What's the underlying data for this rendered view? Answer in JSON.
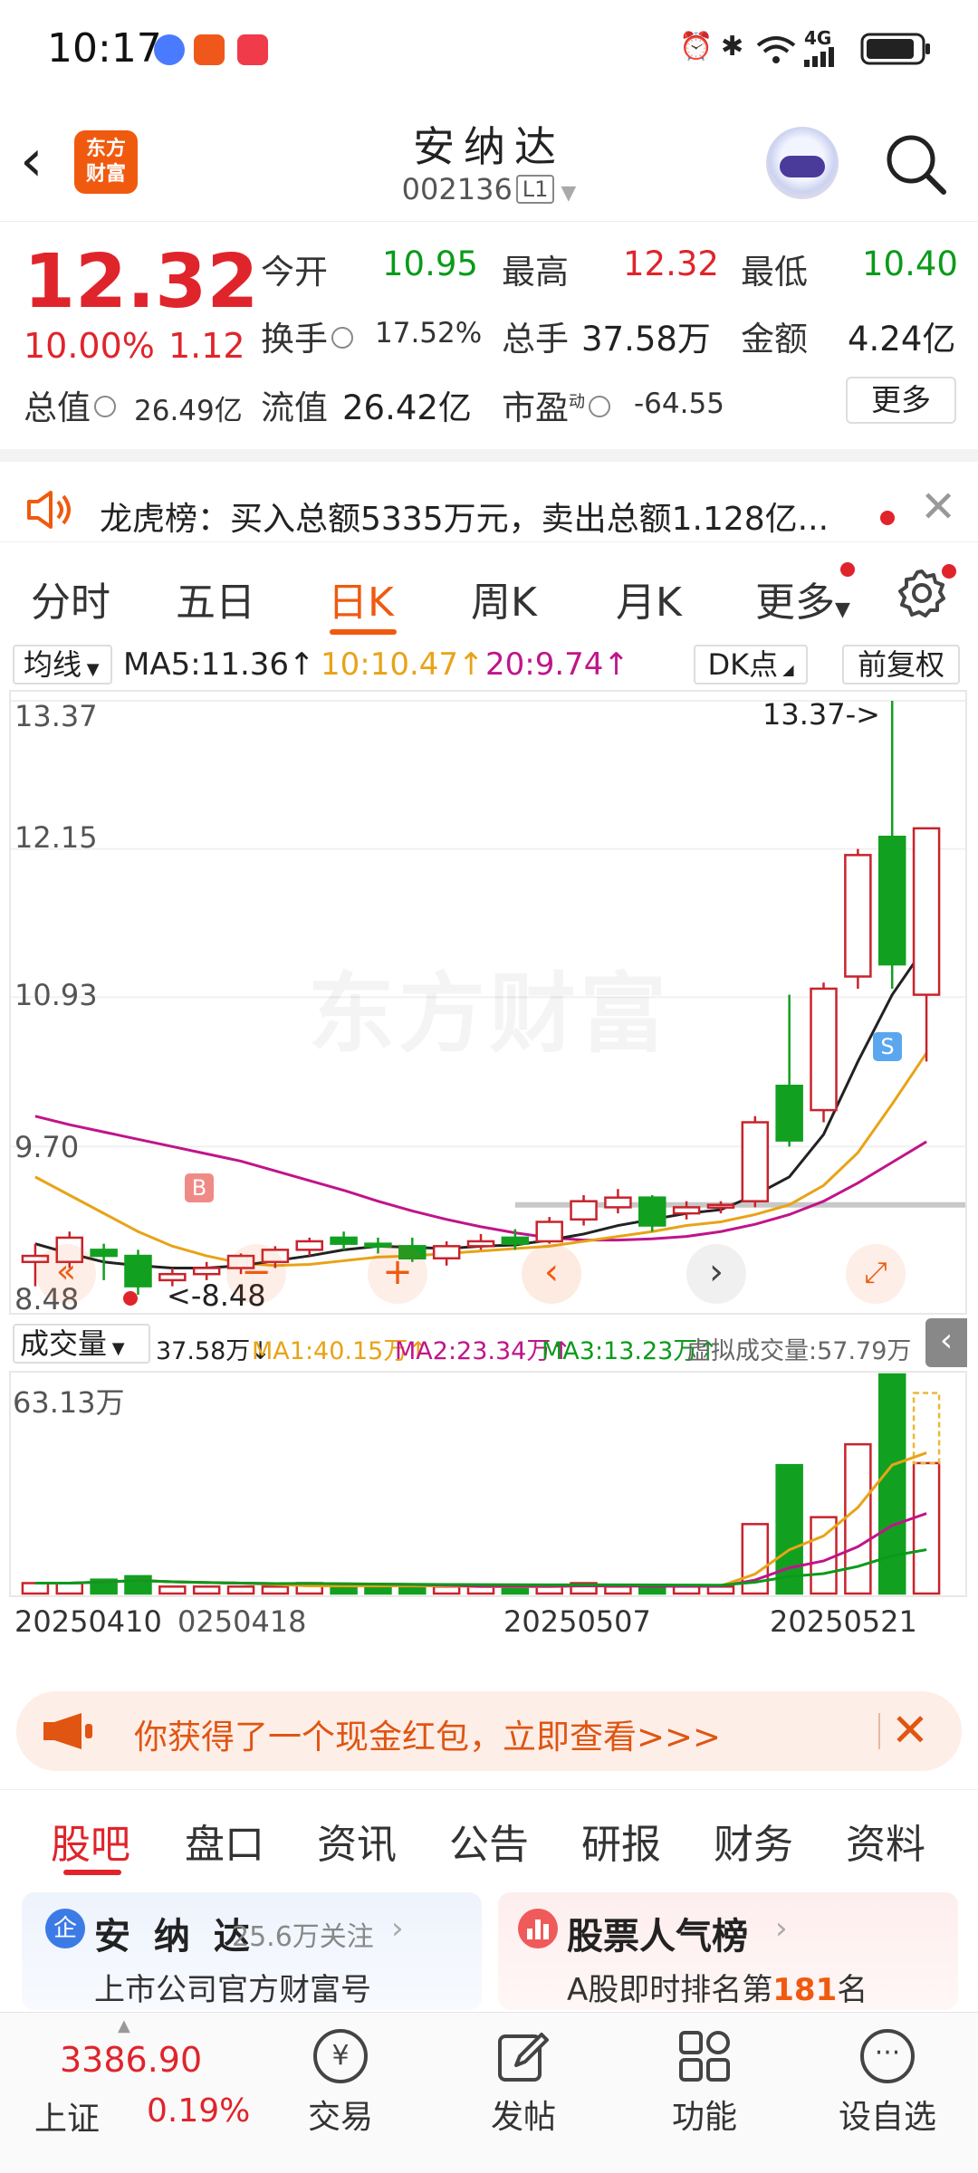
{
  "status_bar": {
    "time": "10:17",
    "network": "4G",
    "battery_icon": "battery-icon"
  },
  "header": {
    "name": "安纳达",
    "code": "002136",
    "level": "L1",
    "logo_text": "东方\n财富"
  },
  "quote": {
    "price": "12.32",
    "change_pct": "10.00%",
    "change": "1.12",
    "open_label": "今开",
    "open": "10.95",
    "high_label": "最高",
    "high": "12.32",
    "low_label": "最低",
    "low": "10.40",
    "turnover_label": "换手",
    "turnover": "17.52%",
    "vol_label": "总手",
    "vol": "37.58万",
    "amount_label": "金额",
    "amount": "4.24亿",
    "mktcap_label": "总值",
    "mktcap": "26.49亿",
    "float_label": "流值",
    "float": "26.42亿",
    "pe_label": "市盈",
    "pe_sup": "动",
    "pe": "-64.55",
    "more": "更多"
  },
  "notice": {
    "text": "龙虎榜：买入总额5335万元，卖出总额1.128亿..."
  },
  "tabs": [
    "分时",
    "五日",
    "日K",
    "周K",
    "月K",
    "更多"
  ],
  "ma_bar": {
    "dropdown": "均线",
    "ma5": "MA5:11.36↑",
    "ma10": "10:10.47↑",
    "ma20": "20:9.74↑",
    "dk": "DK点",
    "adjust": "前复权"
  },
  "chart": {
    "y_labels": [
      "13.37",
      "12.15",
      "10.93",
      "9.70",
      "8.48"
    ],
    "max_marker": "13.37->",
    "min_marker": "<-8.48",
    "buy_marker": "B",
    "sell_marker": "S",
    "watermark": "东方财富"
  },
  "volume_bar": {
    "dropdown": "成交量",
    "vol": "37.58万↓",
    "ma1": "MA1:40.15万↑",
    "ma2": "MA2:23.34万↑",
    "ma3": "MA3:13.23万↑",
    "virtual": "虚拟成交量:57.79万",
    "max_label": "63.13万"
  },
  "dates": [
    "20250410",
    "0250418",
    "20250507",
    "20250521"
  ],
  "banner": {
    "text": "你获得了一个现金红包，立即查看>>>"
  },
  "sub_tabs": [
    "股吧",
    "盘口",
    "资讯",
    "公告",
    "研报",
    "财务",
    "资料"
  ],
  "cards": [
    {
      "title": "安 纳 达",
      "followers": "25.6万关注",
      "sub": "上市公司官方财富号"
    },
    {
      "title": "股票人气榜",
      "sub_prefix": "A股即时排名第",
      "rank": "181",
      "sub_suffix": "名"
    }
  ],
  "bottom_nav": {
    "index_value": "3386.90",
    "index_name": "上证",
    "index_change": "0.19%",
    "items": [
      "交易",
      "发帖",
      "功能",
      "设自选"
    ]
  },
  "chart_data": {
    "type": "candlestick",
    "y_range": [
      8.48,
      13.37
    ],
    "candles": [
      {
        "o": 8.75,
        "c": 8.8,
        "h": 8.9,
        "l": 8.55
      },
      {
        "o": 8.75,
        "c": 8.95,
        "h": 9.0,
        "l": 8.7
      },
      {
        "o": 8.85,
        "c": 8.8,
        "h": 8.9,
        "l": 8.6
      },
      {
        "o": 8.8,
        "c": 8.55,
        "h": 8.85,
        "l": 8.48
      },
      {
        "o": 8.6,
        "c": 8.65,
        "h": 8.7,
        "l": 8.55
      },
      {
        "o": 8.65,
        "c": 8.7,
        "h": 8.75,
        "l": 8.6
      },
      {
        "o": 8.7,
        "c": 8.8,
        "h": 8.82,
        "l": 8.65
      },
      {
        "o": 8.75,
        "c": 8.85,
        "h": 8.88,
        "l": 8.7
      },
      {
        "o": 8.85,
        "c": 8.92,
        "h": 8.95,
        "l": 8.8
      },
      {
        "o": 8.95,
        "c": 8.9,
        "h": 9.0,
        "l": 8.85
      },
      {
        "o": 8.9,
        "c": 8.88,
        "h": 8.95,
        "l": 8.82
      },
      {
        "o": 8.88,
        "c": 8.78,
        "h": 8.95,
        "l": 8.75
      },
      {
        "o": 8.78,
        "c": 8.88,
        "h": 8.92,
        "l": 8.72
      },
      {
        "o": 8.88,
        "c": 8.92,
        "h": 8.98,
        "l": 8.85
      },
      {
        "o": 8.95,
        "c": 8.9,
        "h": 9.02,
        "l": 8.85
      },
      {
        "o": 8.92,
        "c": 9.08,
        "h": 9.12,
        "l": 8.9
      },
      {
        "o": 9.1,
        "c": 9.25,
        "h": 9.3,
        "l": 9.05
      },
      {
        "o": 9.2,
        "c": 9.28,
        "h": 9.35,
        "l": 9.15
      },
      {
        "o": 9.28,
        "c": 9.05,
        "h": 9.3,
        "l": 9.0
      },
      {
        "o": 9.15,
        "c": 9.2,
        "h": 9.25,
        "l": 9.1
      },
      {
        "o": 9.2,
        "c": 9.22,
        "h": 9.25,
        "l": 9.15
      },
      {
        "o": 9.25,
        "c": 9.9,
        "h": 9.95,
        "l": 9.2
      },
      {
        "o": 10.2,
        "c": 9.75,
        "h": 10.95,
        "l": 9.7
      },
      {
        "o": 10.0,
        "c": 11.0,
        "h": 11.05,
        "l": 9.9
      },
      {
        "o": 11.1,
        "c": 12.1,
        "h": 12.15,
        "l": 11.0
      },
      {
        "o": 12.25,
        "c": 11.2,
        "h": 13.37,
        "l": 11.0
      },
      {
        "o": 10.95,
        "c": 12.32,
        "h": 12.32,
        "l": 10.4
      }
    ],
    "ma5": [
      8.9,
      8.82,
      8.75,
      8.72,
      8.7,
      8.7,
      8.72,
      8.76,
      8.8,
      8.85,
      8.88,
      8.87,
      8.86,
      8.88,
      8.89,
      8.93,
      8.98,
      9.05,
      9.1,
      9.15,
      9.18,
      9.3,
      9.45,
      9.8,
      10.4,
      10.95,
      11.36
    ],
    "ma10": [
      9.45,
      9.3,
      9.15,
      9.0,
      8.88,
      8.8,
      8.74,
      8.72,
      8.73,
      8.76,
      8.79,
      8.8,
      8.82,
      8.84,
      8.86,
      8.88,
      8.92,
      8.96,
      9.0,
      9.05,
      9.08,
      9.14,
      9.22,
      9.38,
      9.65,
      10.05,
      10.47
    ],
    "ma20": [
      9.95,
      9.88,
      9.82,
      9.76,
      9.7,
      9.64,
      9.58,
      9.5,
      9.42,
      9.34,
      9.25,
      9.17,
      9.1,
      9.04,
      8.99,
      8.95,
      8.93,
      8.93,
      8.94,
      8.96,
      9.0,
      9.06,
      9.14,
      9.25,
      9.4,
      9.57,
      9.74
    ],
    "volume": [
      3,
      3,
      4,
      5,
      2,
      2,
      2,
      2,
      3,
      2,
      2,
      2,
      2,
      2,
      2,
      2,
      3,
      2,
      2,
      2,
      2,
      20,
      37,
      22,
      43,
      63.13,
      37.58
    ],
    "virtual_volume": 57.79
  }
}
